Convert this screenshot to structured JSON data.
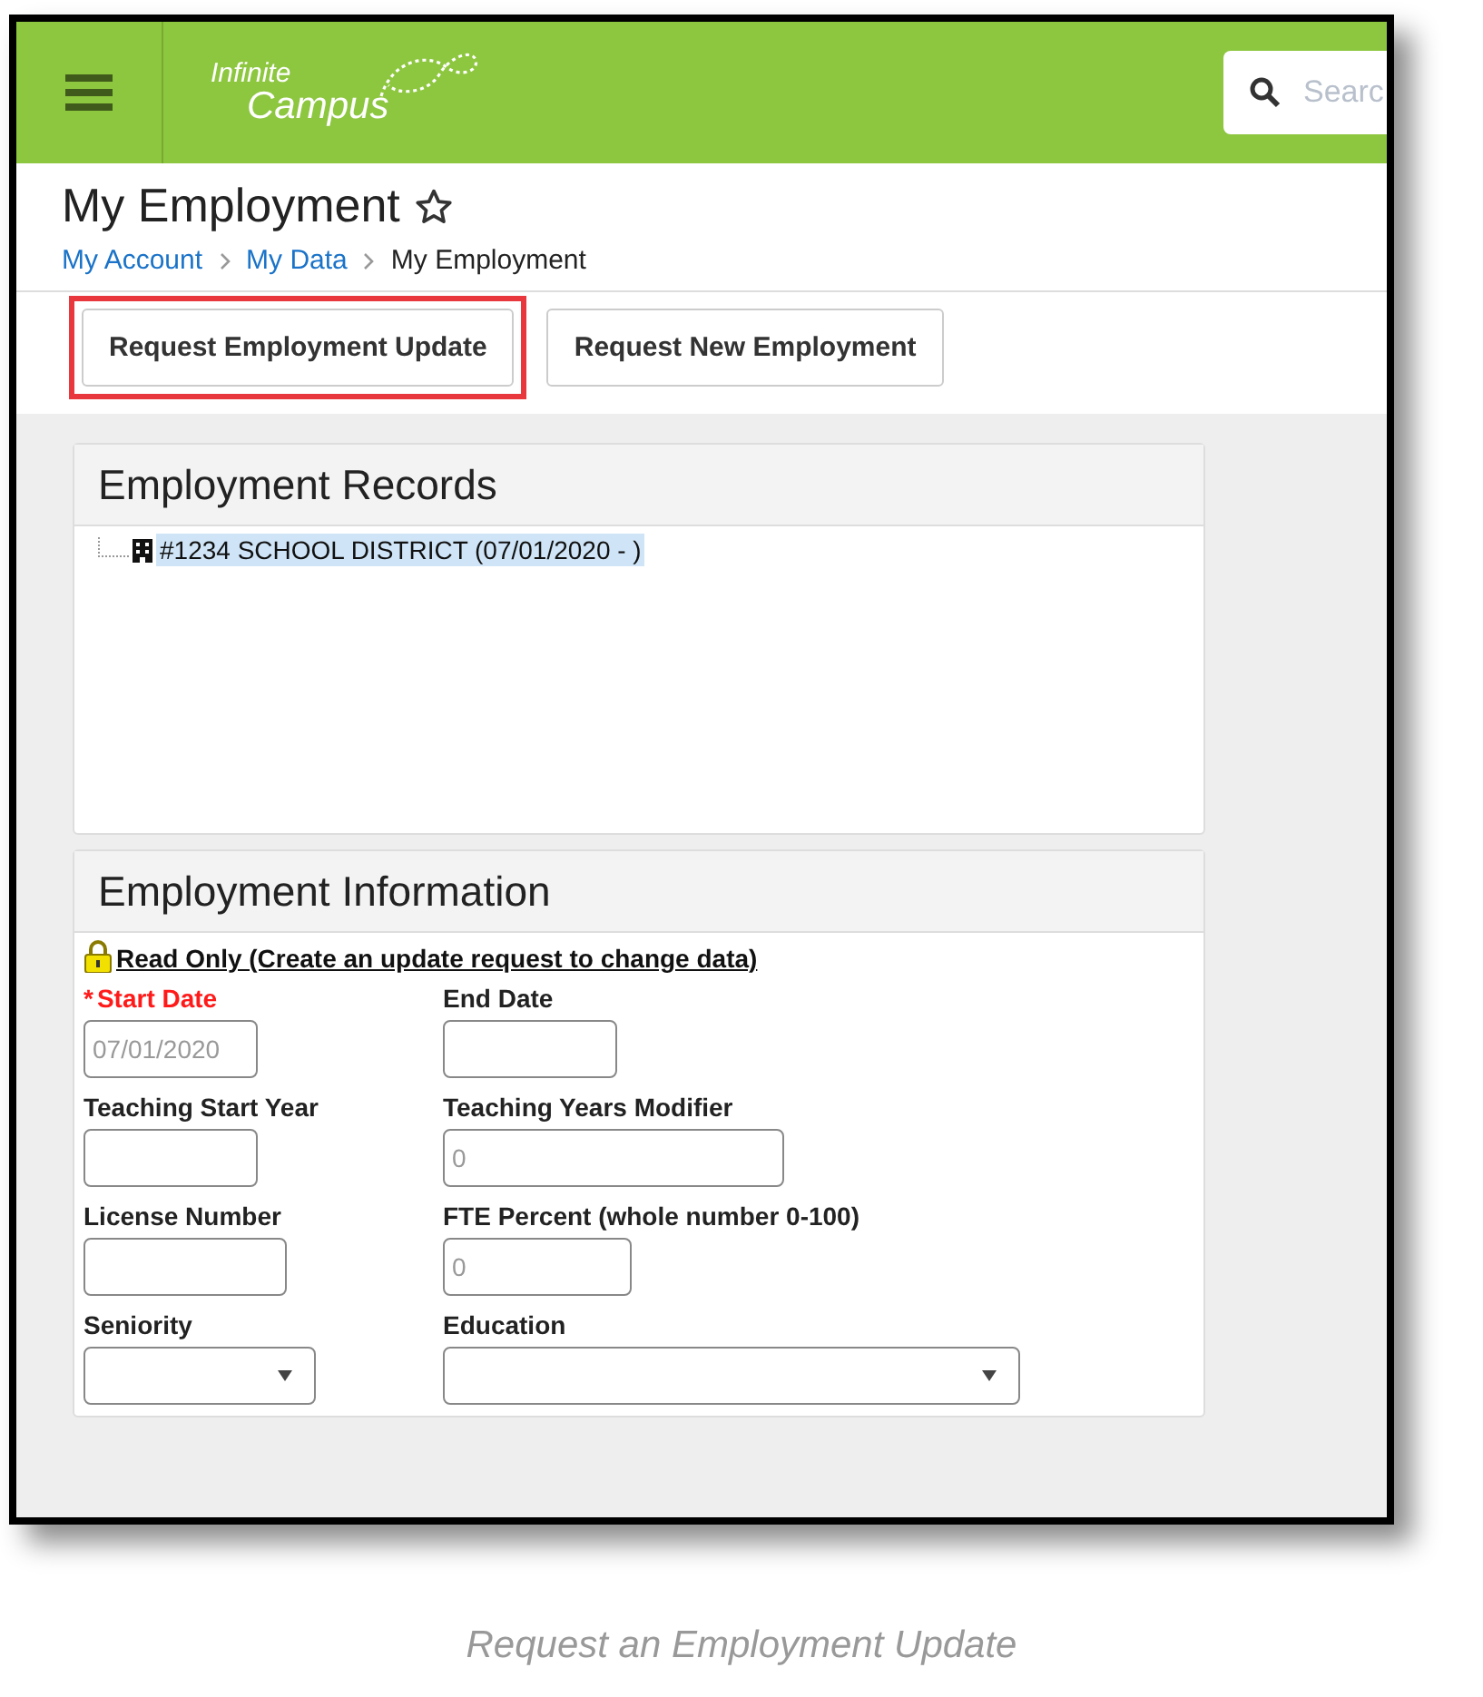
{
  "header": {
    "logo_line_1": "Infinite",
    "logo_line_2": "Campus",
    "search": {
      "placeholder": "Searc"
    }
  },
  "page": {
    "title": "My Employment",
    "favorite": false,
    "breadcrumb": [
      {
        "label": "My Account",
        "link": true
      },
      {
        "label": "My Data",
        "link": true
      },
      {
        "label": "My Employment",
        "link": false
      }
    ]
  },
  "actions": [
    {
      "label": "Request Employment Update",
      "highlighted": true
    },
    {
      "label": "Request New Employment",
      "highlighted": false
    }
  ],
  "records_panel": {
    "title": "Employment Records",
    "items": [
      {
        "label": "#1234 SCHOOL DISTRICT (07/01/2020 - )",
        "selected": true
      }
    ]
  },
  "info_panel": {
    "title": "Employment Information",
    "notice": "Read Only (Create an update request to change data)",
    "required_mark": "*",
    "fields": [
      {
        "label": "Start Date",
        "kind": "text",
        "required": true,
        "value": "07/01/2020"
      },
      {
        "label": "End Date",
        "kind": "text",
        "required": false
      },
      {
        "label": "Teaching Start Year",
        "kind": "text",
        "required": false
      },
      {
        "label": "Teaching Years Modifier",
        "kind": "text",
        "required": false,
        "value": "0"
      },
      {
        "label": "License Number",
        "kind": "text",
        "required": false
      },
      {
        "label": "FTE Percent (whole number 0-100)",
        "kind": "text",
        "required": false,
        "value": "0"
      },
      {
        "label": "Seniority",
        "kind": "select",
        "required": false
      },
      {
        "label": "Education",
        "kind": "select",
        "required": false
      }
    ]
  },
  "caption": "Request an Employment Update"
}
